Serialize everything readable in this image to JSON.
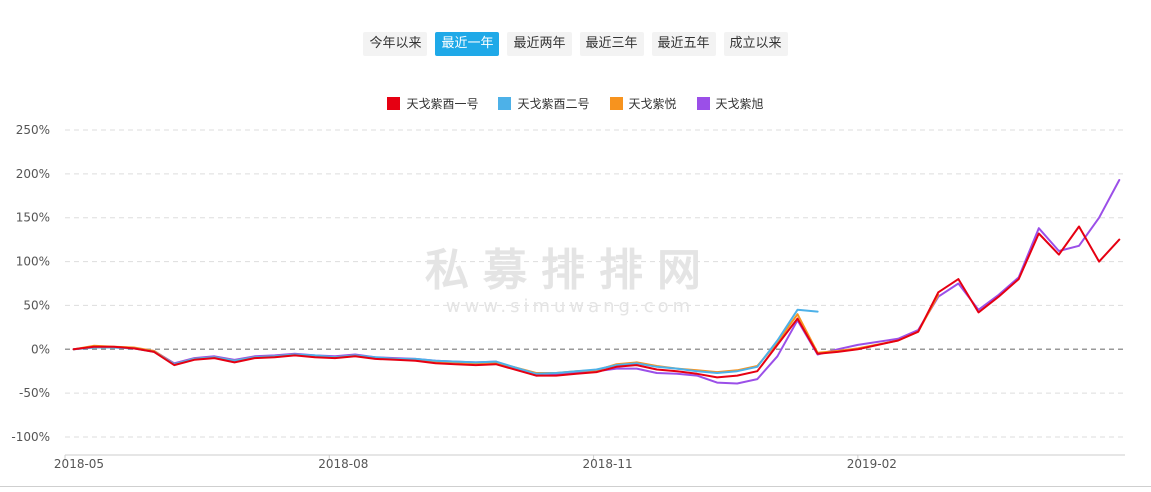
{
  "range_tabs": [
    {
      "label": "今年以来",
      "active": false
    },
    {
      "label": "最近一年",
      "active": true
    },
    {
      "label": "最近两年",
      "active": false
    },
    {
      "label": "最近三年",
      "active": false
    },
    {
      "label": "最近五年",
      "active": false
    },
    {
      "label": "成立以来",
      "active": false
    }
  ],
  "colors": {
    "active_tab": "#1fa9e8",
    "zero_line": "#999999",
    "grid": "#dddddd"
  },
  "watermark": {
    "main": "私募排排网",
    "sub": "www.simuwang.com"
  },
  "chart_data": {
    "type": "line",
    "x_tick_labels": [
      "2018-05",
      "2018-08",
      "2018-11",
      "2019-02"
    ],
    "y_tick_labels": [
      "250%",
      "200%",
      "150%",
      "100%",
      "50%",
      "0%",
      "-50%",
      "-100%"
    ],
    "ylim": [
      -100,
      250
    ],
    "y_unit": "%",
    "grid": true,
    "legend_position": "top-center",
    "series": [
      {
        "name": "天戈紫酉一号",
        "color": "#e60012",
        "x": [
          "2018-05-04",
          "2018-05-11",
          "2018-05-18",
          "2018-05-25",
          "2018-06-01",
          "2018-06-08",
          "2018-06-15",
          "2018-06-22",
          "2018-06-29",
          "2018-07-06",
          "2018-07-13",
          "2018-07-20",
          "2018-07-27",
          "2018-08-03",
          "2018-08-10",
          "2018-08-17",
          "2018-08-24",
          "2018-08-31",
          "2018-09-07",
          "2018-09-14",
          "2018-09-21",
          "2018-09-28",
          "2018-10-12",
          "2018-10-19",
          "2018-10-26",
          "2018-11-02",
          "2018-11-09",
          "2018-11-16",
          "2018-11-23",
          "2018-11-30",
          "2018-12-07",
          "2018-12-14",
          "2018-12-21",
          "2018-12-28",
          "2019-01-04",
          "2019-01-11",
          "2019-01-18",
          "2019-01-25",
          "2019-02-01",
          "2019-02-15",
          "2019-02-22",
          "2019-03-01",
          "2019-03-08",
          "2019-03-15",
          "2019-03-22",
          "2019-03-29",
          "2019-04-05",
          "2019-04-12",
          "2019-04-19",
          "2019-04-26",
          "2019-05-03"
        ],
        "y": [
          0,
          3,
          3,
          1,
          -3,
          -18,
          -12,
          -10,
          -15,
          -10,
          -9,
          -7,
          -9,
          -10,
          -8,
          -11,
          -12,
          -13,
          -16,
          -17,
          -18,
          -17,
          -30,
          -30,
          -28,
          -26,
          -20,
          -18,
          -23,
          -25,
          -28,
          -32,
          -30,
          -25,
          5,
          35,
          -5,
          -3,
          0,
          10,
          20,
          65,
          80,
          42,
          60,
          80,
          132,
          108,
          140,
          100,
          125
        ]
      },
      {
        "name": "天戈紫酉二号",
        "color": "#4db1e8",
        "x": [
          "2018-05-04",
          "2018-05-11",
          "2018-05-18",
          "2018-05-25",
          "2018-06-01",
          "2018-06-08",
          "2018-06-15",
          "2018-06-22",
          "2018-06-29",
          "2018-07-06",
          "2018-07-13",
          "2018-07-20",
          "2018-07-27",
          "2018-08-03",
          "2018-08-10",
          "2018-08-17",
          "2018-08-24",
          "2018-08-31",
          "2018-09-07",
          "2018-09-14",
          "2018-09-21",
          "2018-09-28",
          "2018-10-12",
          "2018-10-19",
          "2018-10-26",
          "2018-11-02",
          "2018-11-09",
          "2018-11-16",
          "2018-11-23",
          "2018-11-30",
          "2018-12-07",
          "2018-12-14",
          "2018-12-21",
          "2018-12-28",
          "2019-01-04",
          "2019-01-11",
          "2019-01-18"
        ],
        "y": [
          0,
          2,
          2,
          1,
          -3,
          -17,
          -11,
          -9,
          -13,
          -9,
          -8,
          -6,
          -7,
          -9,
          -7,
          -9,
          -11,
          -11,
          -13,
          -14,
          -15,
          -14,
          -28,
          -27,
          -25,
          -23,
          -18,
          -16,
          -20,
          -22,
          -25,
          -27,
          -25,
          -20,
          10,
          45,
          43
        ]
      },
      {
        "name": "天戈紫悦",
        "color": "#f7931e",
        "x": [
          "2018-05-04",
          "2018-05-11",
          "2018-05-18",
          "2018-05-25",
          "2018-06-01",
          "2018-06-08",
          "2018-06-15",
          "2018-06-22",
          "2018-06-29",
          "2018-07-06",
          "2018-07-13",
          "2018-07-20",
          "2018-07-27",
          "2018-08-03",
          "2018-08-10",
          "2018-08-17",
          "2018-08-24",
          "2018-08-31",
          "2018-09-07",
          "2018-09-14",
          "2018-09-21",
          "2018-09-28",
          "2018-10-12",
          "2018-10-19",
          "2018-10-26",
          "2018-11-02",
          "2018-11-09",
          "2018-11-16",
          "2018-11-23",
          "2018-11-30",
          "2018-12-07",
          "2018-12-14",
          "2018-12-21",
          "2018-12-28",
          "2019-01-04",
          "2019-01-11",
          "2019-01-18",
          "2019-01-25",
          "2019-02-01",
          "2019-02-15",
          "2019-02-22",
          "2019-03-01"
        ],
        "y": [
          0,
          4,
          3,
          2,
          -2,
          -17,
          -11,
          -9,
          -13,
          -9,
          -8,
          -6,
          -8,
          -9,
          -7,
          -10,
          -11,
          -12,
          -14,
          -15,
          -16,
          -15,
          -27,
          -27,
          -25,
          -24,
          -17,
          -15,
          -19,
          -22,
          -24,
          -26,
          -24,
          -19,
          8,
          40,
          -4,
          -2,
          1,
          10,
          20,
          62
        ]
      },
      {
        "name": "天戈紫旭",
        "color": "#9b4fe8",
        "x": [
          "2018-05-04",
          "2018-05-11",
          "2018-05-18",
          "2018-05-25",
          "2018-06-01",
          "2018-06-08",
          "2018-06-15",
          "2018-06-22",
          "2018-06-29",
          "2018-07-06",
          "2018-07-13",
          "2018-07-20",
          "2018-07-27",
          "2018-08-03",
          "2018-08-10",
          "2018-08-17",
          "2018-08-24",
          "2018-08-31",
          "2018-09-07",
          "2018-09-14",
          "2018-09-21",
          "2018-09-28",
          "2018-10-12",
          "2018-10-19",
          "2018-10-26",
          "2018-11-02",
          "2018-11-09",
          "2018-11-16",
          "2018-11-23",
          "2018-11-30",
          "2018-12-07",
          "2018-12-14",
          "2018-12-21",
          "2018-12-28",
          "2019-01-04",
          "2019-01-11",
          "2019-01-18",
          "2019-01-25",
          "2019-02-01",
          "2019-02-15",
          "2019-02-22",
          "2019-03-01",
          "2019-03-08",
          "2019-03-15",
          "2019-03-22",
          "2019-03-29",
          "2019-04-05",
          "2019-04-12",
          "2019-04-19",
          "2019-04-26",
          "2019-05-03"
        ],
        "y": [
          0,
          2,
          2,
          1,
          -2,
          -16,
          -10,
          -8,
          -12,
          -8,
          -7,
          -5,
          -7,
          -8,
          -6,
          -9,
          -10,
          -11,
          -13,
          -14,
          -15,
          -14,
          -30,
          -29,
          -27,
          -25,
          -22,
          -22,
          -27,
          -28,
          -30,
          -38,
          -39,
          -34,
          -8,
          33,
          -6,
          0,
          5,
          12,
          22,
          60,
          75,
          45,
          62,
          82,
          138,
          112,
          118,
          150,
          193
        ]
      }
    ]
  }
}
